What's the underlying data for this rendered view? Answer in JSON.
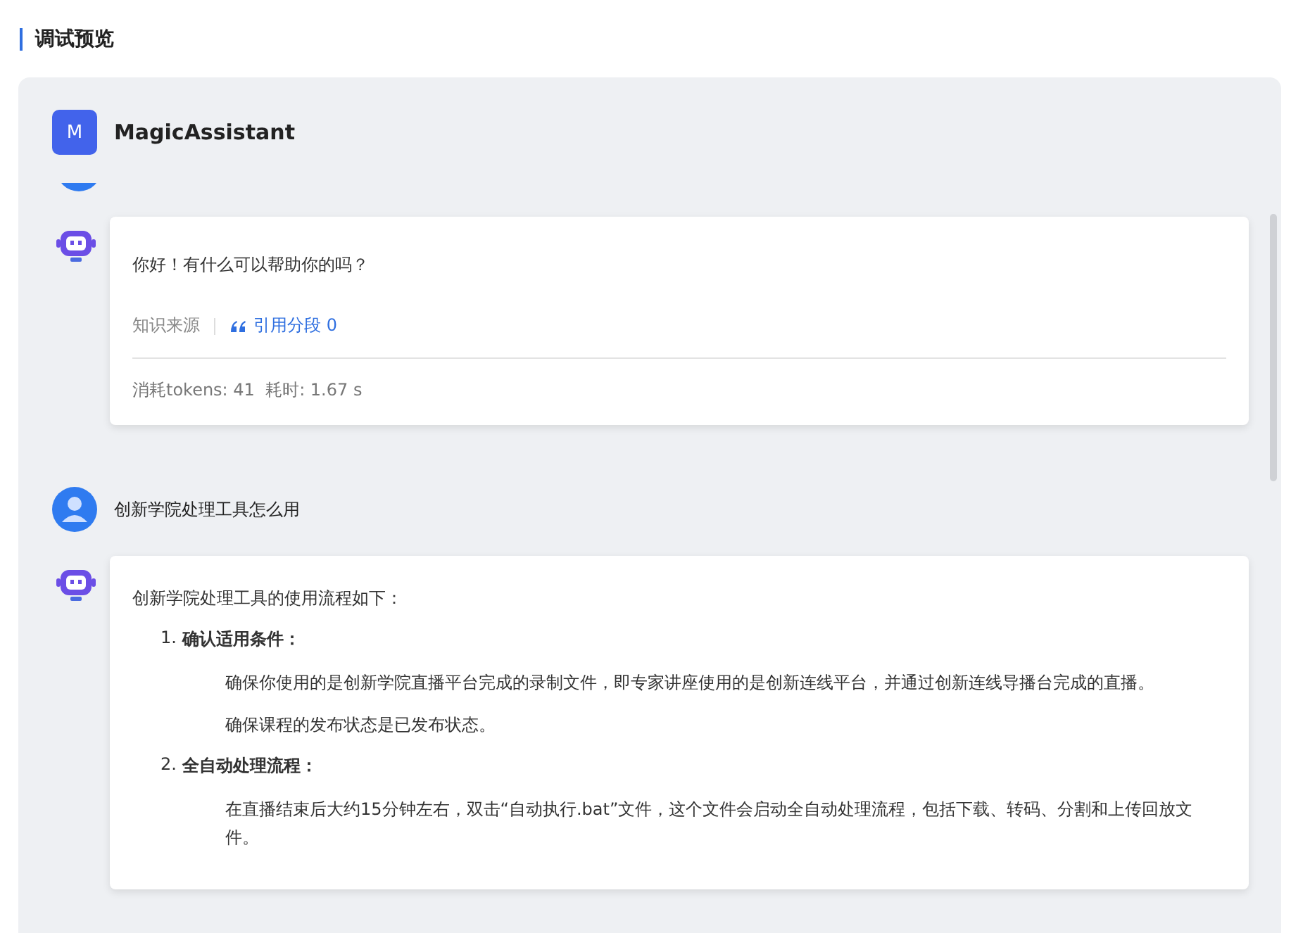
{
  "page_title": "调试预览",
  "assistant": {
    "avatar_letter": "M",
    "name": "MagicAssistant"
  },
  "messages": [
    {
      "kind": "bot",
      "text": "你好！有什么可以帮助你的吗？",
      "source_label": "知识来源",
      "citation": "引用分段 0",
      "stats": "消耗tokens: 41  耗时: 1.67 s"
    },
    {
      "kind": "user",
      "text": "创新学院处理工具怎么用"
    },
    {
      "kind": "answer",
      "intro": "创新学院处理工具的使用流程如下：",
      "steps": [
        {
          "number": "1.",
          "title": "确认适用条件：",
          "paragraphs": [
            "确保你使用的是创新学院直播平台完成的录制文件，即专家讲座使用的是创新连线平台，并通过创新连线导播台完成的直播。",
            "确保课程的发布状态是已发布状态。"
          ]
        },
        {
          "number": "2.",
          "title": "全自动处理流程：",
          "paragraphs": [
            "在直播结束后大约15分钟左右，双击“自动执行.bat”文件，这个文件会启动全自动处理流程，包括下载、转码、分割和上传回放文件。"
          ]
        }
      ]
    }
  ]
}
